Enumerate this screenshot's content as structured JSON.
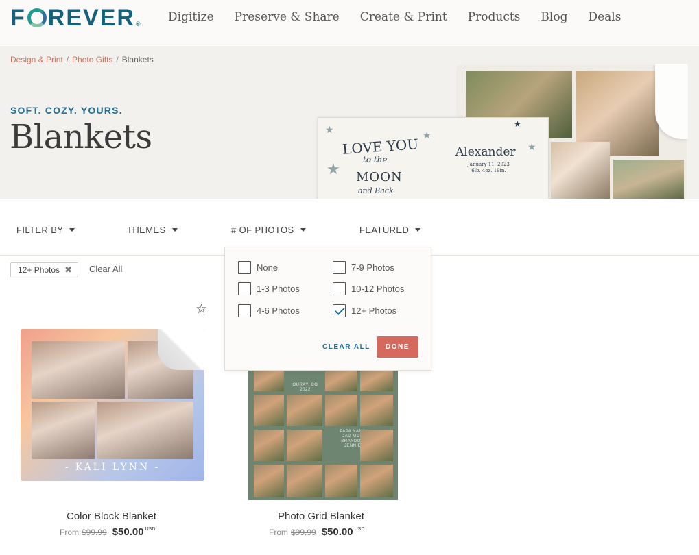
{
  "brand": {
    "logo_prefix": "F",
    "logo_suffix": "REVER",
    "logo_reg": "®",
    "colors": {
      "primary": "#1e6f93",
      "accent": "#d5695d",
      "link": "#c8735f"
    }
  },
  "nav": {
    "items": [
      {
        "label": "Digitize"
      },
      {
        "label": "Preserve & Share"
      },
      {
        "label": "Create & Print"
      },
      {
        "label": "Products"
      },
      {
        "label": "Blog"
      },
      {
        "label": "Deals"
      }
    ]
  },
  "breadcrumb": {
    "items": [
      {
        "label": "Design & Print"
      },
      {
        "label": "Photo Gifts"
      },
      {
        "label": "Blankets"
      }
    ],
    "separator": "/"
  },
  "hero": {
    "tagline": "SOFT. COZY. YOURS.",
    "title": "Blankets",
    "art": {
      "love_you": "LOVE YOU",
      "to_the": "to the",
      "moon": "MOON",
      "and_back": "and Back",
      "name": "Alexander",
      "date_line1": "January 11, 2023",
      "date_line2": "6lb. 4oz. 19in."
    }
  },
  "filters": {
    "filter_by": "FILTER BY",
    "themes": "THEMES",
    "num_photos": "# OF PHOTOS",
    "featured": "FEATURED"
  },
  "active_filters": {
    "chip_label": "12+ Photos",
    "chip_remove_icon": "close-icon",
    "clear_all": "Clear All"
  },
  "photo_dropdown": {
    "options": [
      {
        "label": "None",
        "checked": false
      },
      {
        "label": "1-3 Photos",
        "checked": false
      },
      {
        "label": "4-6 Photos",
        "checked": false
      },
      {
        "label": "7-9 Photos",
        "checked": false
      },
      {
        "label": "10-12 Photos",
        "checked": false
      },
      {
        "label": "12+ Photos",
        "checked": true
      }
    ],
    "clear_all": "CLEAR ALL",
    "done": "DONE"
  },
  "products": [
    {
      "name": "Color Block Blanket",
      "from": "From",
      "old_price": "$99.99",
      "price": "$50.00",
      "currency": "USD",
      "image_text": "- KALI LYNN -"
    },
    {
      "name": "Photo Grid Blanket",
      "from": "From",
      "old_price": "$99.99",
      "price": "$50.00",
      "currency": "USD",
      "image_text_1": "OURAY, CO 2022",
      "image_text_2": "PAPA NANA DAD MOM BRANDON JENNIE"
    }
  ]
}
